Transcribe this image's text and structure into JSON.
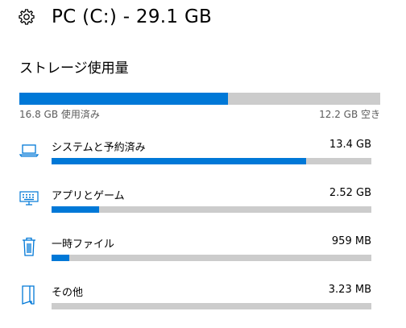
{
  "header": {
    "title": "PC (C:) - 29.1 GB",
    "icon": "gear-icon"
  },
  "storage": {
    "section_title": "ストレージ使用量",
    "used_label": "16.8 GB 使用済み",
    "free_label": "12.2 GB 空き",
    "used_fraction": 0.578
  },
  "categories": [
    {
      "name": "システムと予約済み",
      "size": "13.4 GB",
      "fraction": 0.797,
      "icon": "laptop-icon"
    },
    {
      "name": "アプリとゲーム",
      "size": "2.52 GB",
      "fraction": 0.149,
      "icon": "keyboard-icon"
    },
    {
      "name": "一時ファイル",
      "size": "959 MB",
      "fraction": 0.055,
      "icon": "trash-icon"
    },
    {
      "name": "その他",
      "size": "3.23 MB",
      "fraction": 0.0,
      "icon": "file-icon"
    }
  ],
  "colors": {
    "accent": "#0078d7",
    "track": "#cccccc",
    "secondary_text": "#5b5b5b"
  }
}
